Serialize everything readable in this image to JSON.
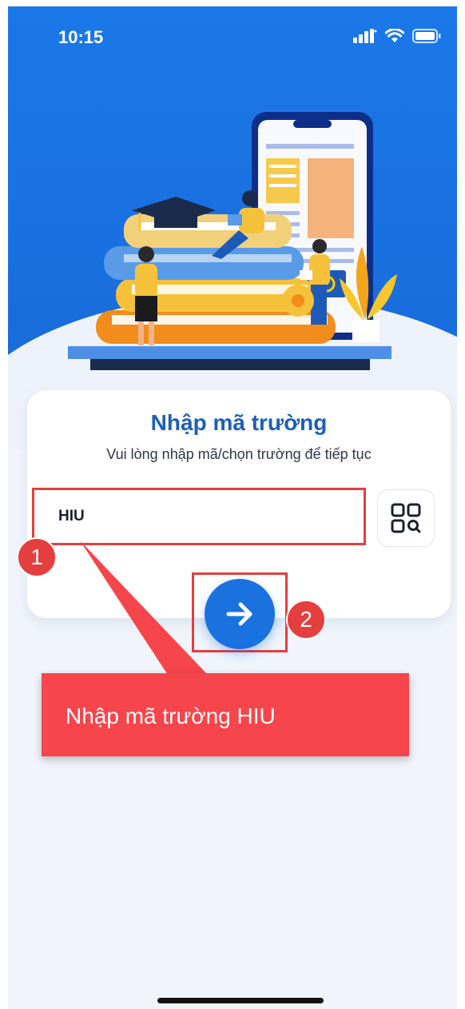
{
  "status_bar": {
    "time": "10:15",
    "icons": [
      "signal-icon",
      "wifi-icon",
      "battery-icon"
    ]
  },
  "card": {
    "title": "Nhập mã trường",
    "subtitle": "Vui lòng nhập mã/chọn trường để tiếp tục",
    "school_code_value": "HIU",
    "qr_icon": "qr-scan-icon",
    "submit_icon": "arrow-right-icon"
  },
  "annotations": {
    "step1": "1",
    "step2": "2",
    "callout": "Nhập mã trường HIU"
  },
  "colors": {
    "primary": "#1a72e0",
    "title": "#1d5fb8",
    "annotation": "#e53e3e",
    "callout": "#f6454b"
  }
}
